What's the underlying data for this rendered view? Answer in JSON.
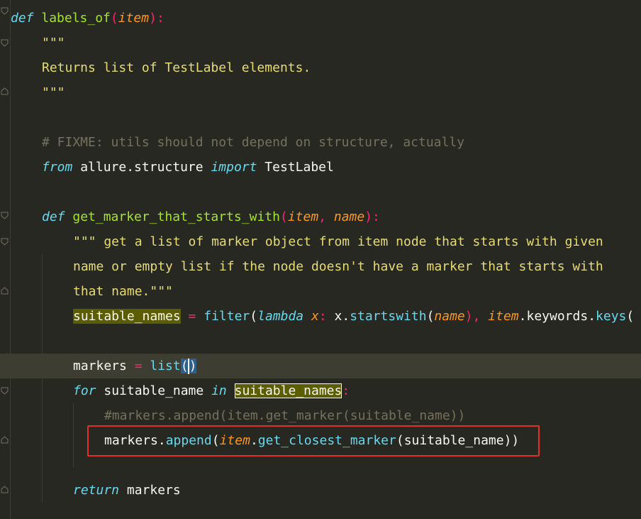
{
  "code": {
    "l1": {
      "def": "def",
      "name": "labels_of",
      "p1": "(",
      "param": "item",
      "p2": "):"
    },
    "l2": {
      "text": "\"\"\""
    },
    "l3": {
      "text": "Returns list of TestLabel elements."
    },
    "l4": {
      "text": "\"\"\""
    },
    "l5": {
      "text": "# FIXME: utils should not depend on structure, actually"
    },
    "l6": {
      "from": "from",
      "mod": " allure.structure ",
      "import": "import",
      "name": " TestLabel"
    },
    "l7": {
      "def": "def",
      "name": "get_marker_that_starts_with",
      "p1": "(",
      "param1": "item",
      "comma": ", ",
      "param2": "name",
      "p2": "):"
    },
    "l8": {
      "text": "\"\"\" get a list of marker object from item node that starts with given"
    },
    "l9": {
      "text": "name or empty list if the node doesn't have a marker that starts with"
    },
    "l10": {
      "text": "that name.\"\"\""
    },
    "l11": {
      "var": "suitable_names",
      "eq": " = ",
      "filter": "filter",
      "p1": "(",
      "lambda": "lambda",
      "x": " x",
      "colon": ": ",
      "x2": "x.",
      "startswith": "startswith",
      "p2": "(",
      "name": "name",
      "p3": "), ",
      "item": "item",
      "kw": ".keywords.",
      "keys": "keys",
      "p4": "("
    },
    "l12": {
      "var": "markers",
      "eq": " = ",
      "list": "list",
      "open": "(",
      "close": ")"
    },
    "l13": {
      "for": "for",
      "var": " suitable_name ",
      "in": "in",
      "space": " ",
      "names": "suitable_names",
      "colon": ":"
    },
    "l14": {
      "text": "#markers.append(item.get_marker(suitable_name))"
    },
    "l15": {
      "obj": "markers.",
      "append": "append",
      "p1": "(",
      "item": "item",
      "dot": ".",
      "method": "get_closest_marker",
      "args": "(suitable_name))"
    },
    "l16": {
      "ret": "return",
      "var": " markers"
    }
  },
  "colors": {
    "background": "#272822",
    "keyword": "#66D9EF",
    "function": "#A6E22E",
    "parameter": "#FD971F",
    "string": "#E6DB74",
    "comment": "#75715E",
    "operator": "#F92672",
    "highlight_box": "#E0302A"
  }
}
